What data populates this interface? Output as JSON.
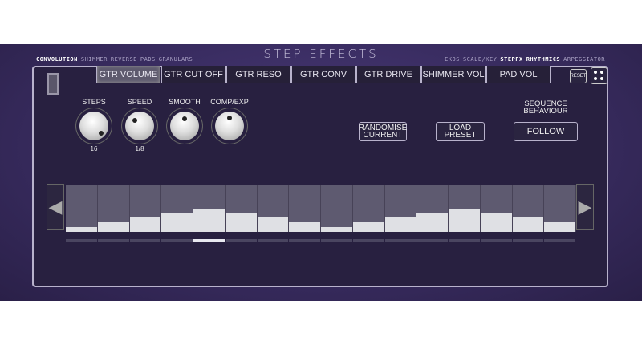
{
  "title": "STEP EFFECTS",
  "nav_left": [
    "CONVOLUTION",
    "SHIMMER",
    "REVERSE",
    "PADS",
    "GRANULARS"
  ],
  "nav_right": [
    "EKOS",
    "SCALE/KEY",
    "STEPFX",
    "RHYTHMICS",
    "ARPEGGIATOR"
  ],
  "tabs": [
    "GTR VOLUME",
    "GTR CUT OFF",
    "GTR RESO",
    "GTR CONV",
    "GTR DRIVE",
    "SHIMMER VOL",
    "PAD VOL"
  ],
  "active_tab": 0,
  "reset_label": "RESET",
  "knobs": [
    {
      "label": "STEPS",
      "value": "16"
    },
    {
      "label": "SPEED",
      "value": "1/8"
    },
    {
      "label": "SMOOTH",
      "value": ""
    },
    {
      "label": "COMP/EXP",
      "value": ""
    }
  ],
  "buttons": {
    "randomise": "RANDOMISE CURRENT",
    "load_preset": "LOAD PRESET",
    "follow": "FOLLOW"
  },
  "sequence_label": "SEQUENCE BEHAVIOUR",
  "steps": [
    0.1,
    0.2,
    0.3,
    0.41,
    0.5,
    0.41,
    0.3,
    0.2,
    0.1,
    0.2,
    0.3,
    0.41,
    0.5,
    0.41,
    0.3,
    0.2
  ],
  "current_step": 5
}
